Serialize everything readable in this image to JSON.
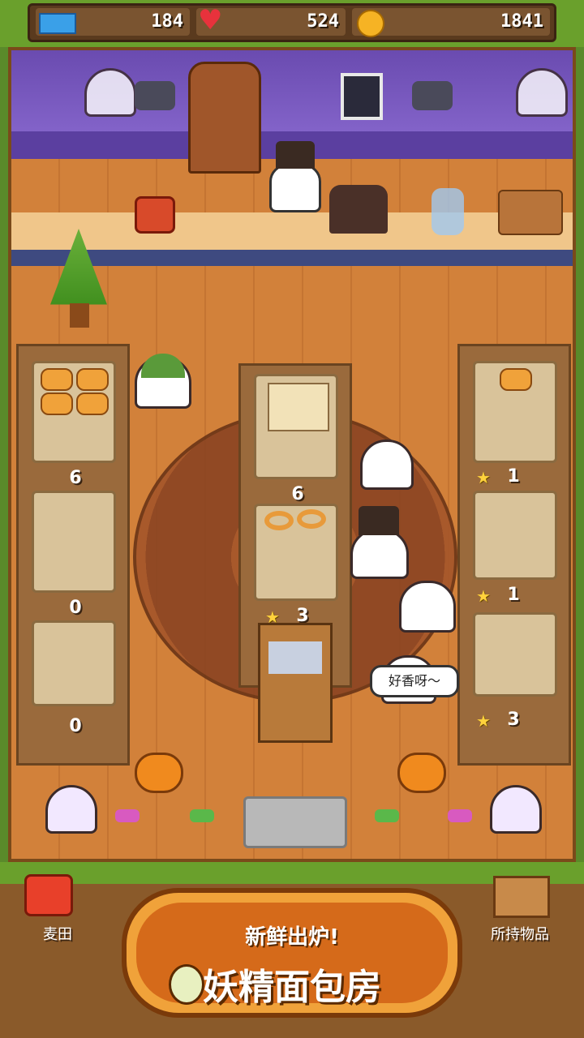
{
  "hud": {
    "tickets": "184",
    "hearts": "524",
    "coins": "1841"
  },
  "shelves": {
    "left": [
      "6",
      "0",
      "0"
    ],
    "center_count": "6",
    "center_stars": "3",
    "right": [
      {
        "stars": "1"
      },
      {
        "stars": "1"
      },
      {
        "stars": "3"
      }
    ]
  },
  "speech": "好香呀～",
  "bottom": {
    "left_label": "麦田",
    "right_label": "所持物品",
    "subtitle": "新鲜出炉!",
    "title": "妖精面包房"
  },
  "colors": {
    "accent": "#d56a1a",
    "grass": "#6aa02c"
  }
}
